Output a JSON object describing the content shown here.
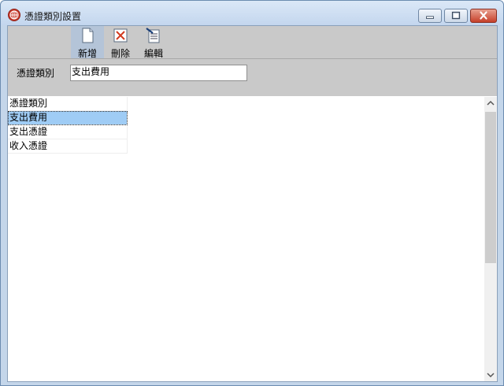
{
  "window": {
    "title": "憑證類別設置",
    "icon": "app-globe-icon"
  },
  "toolbar": {
    "new_label": "新增",
    "delete_label": "刪除",
    "edit_label": "編輯"
  },
  "form": {
    "category_label": "憑證類別",
    "category_value": "支出費用"
  },
  "grid": {
    "header": "憑證類別",
    "rows": [
      "支出費用",
      "支出憑證",
      "收入憑證"
    ],
    "selected_index": 0
  },
  "colors": {
    "selection": "#9fccf5",
    "toolbar_bg": "#c9c9c9",
    "close_button": "#c6402a"
  }
}
